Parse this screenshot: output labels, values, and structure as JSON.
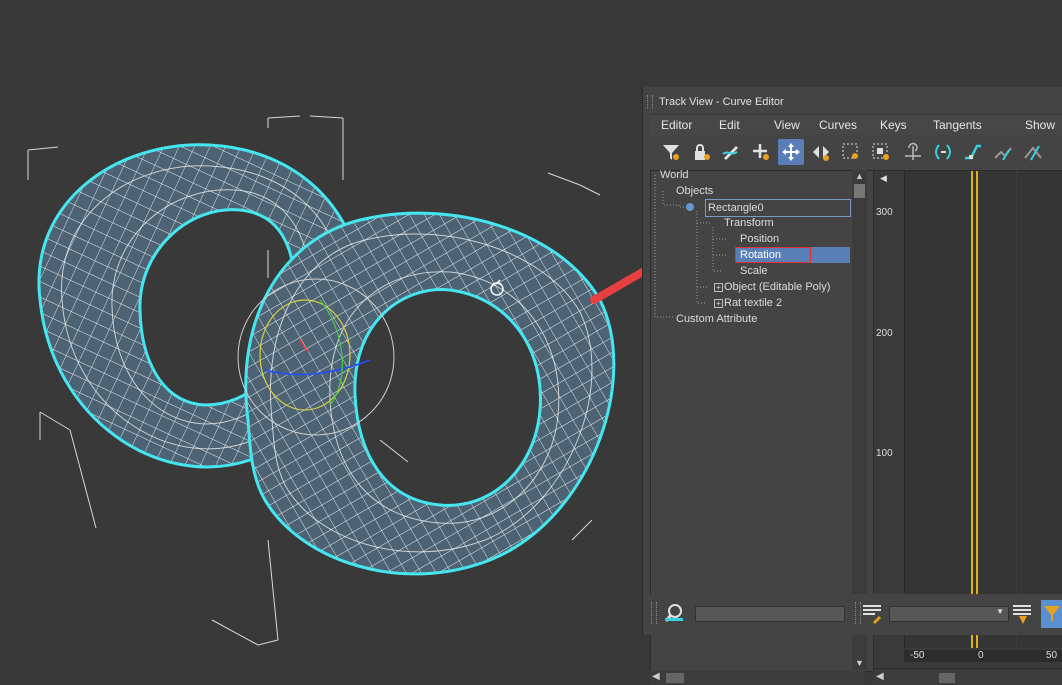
{
  "window": {
    "title": "Track View - Curve Editor"
  },
  "menu": [
    "Editor",
    "Edit",
    "View",
    "Curves",
    "Keys",
    "Tangents",
    "Show"
  ],
  "toolbar": {
    "buttons": [
      {
        "icon": "filter-icon"
      },
      {
        "icon": "lock-icon"
      },
      {
        "icon": "draw-curves-icon"
      },
      {
        "icon": "add-key-icon"
      },
      {
        "icon": "move-keys-icon",
        "active": true
      },
      {
        "icon": "slide-keys-icon"
      },
      {
        "icon": "scale-keys-icon"
      },
      {
        "icon": "scale-values-icon"
      },
      {
        "icon": "insert-time-icon"
      },
      {
        "icon": "tangent-icon"
      },
      {
        "icon": "auto-tangent-icon"
      },
      {
        "icon": "smooth-tangent-icon"
      },
      {
        "icon": "linear-tangent-icon"
      }
    ]
  },
  "tree": {
    "world": "World",
    "objects": "Objects",
    "rectangle": "Rectangle0",
    "transform": "Transform",
    "position": "Position",
    "rotation": "Rotation",
    "scale": "Scale",
    "object_poly": "Object (Editable Poly)",
    "rat_textile": "Rat textile 2",
    "custom_attribute": "Custom Attribute"
  },
  "graph": {
    "y_ticks": [
      "300",
      "200",
      "100"
    ],
    "x_ticks": [
      "-50",
      "0",
      "50"
    ],
    "accent_color": "#e0b020"
  },
  "colors": {
    "viewport_bg": "#393939",
    "wire_outline": "#46e6f0",
    "wire": "#ffffff",
    "mesh_fill": "#4d6373",
    "selection": "#5a7fb6",
    "highlight_box": "#e0303a",
    "arrow": "#e84040"
  }
}
